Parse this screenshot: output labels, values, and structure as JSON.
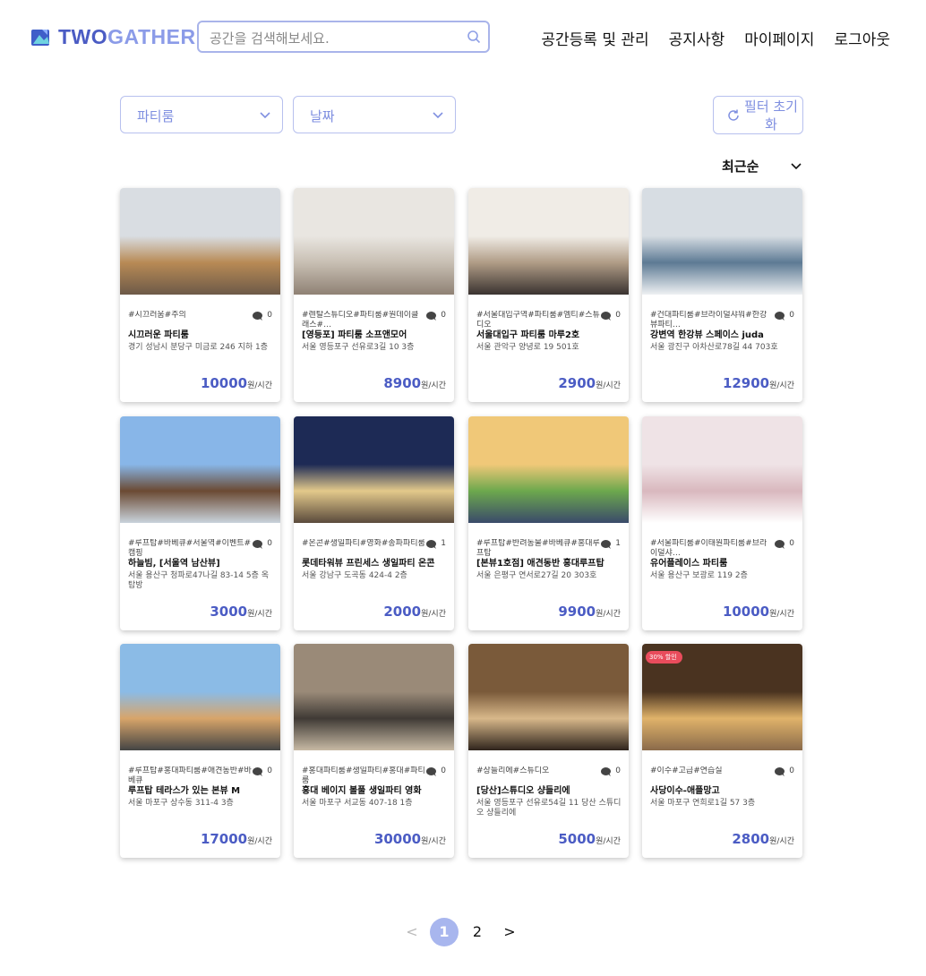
{
  "header": {
    "logo_two": "TWO",
    "logo_gather": "GATHER",
    "search_placeholder": "공간을 검색해보세요.",
    "nav": [
      "공간등록 및 관리",
      "공지사항",
      "마이페이지",
      "로그아웃"
    ]
  },
  "filters": {
    "category": "파티룸",
    "date": "날짜",
    "reset": "필터 초기화",
    "sort": "최근순"
  },
  "price_unit": "원/시간",
  "cards": [
    {
      "tags": "#시끄러움#주의",
      "comments": "0",
      "name": "시끄러운 파티룸",
      "address": "경기 성남시 분당구 미금로 246 지하 1층",
      "price": "10000"
    },
    {
      "tags": "#렌탈스튜디오#파티룸#원데이클래스#…",
      "comments": "0",
      "name": "[영등포] 파티룸 소프앤모어",
      "address": "서울 영등포구 선유로3길 10 3층",
      "price": "8900"
    },
    {
      "tags": "#서울대입구역#파티룸#엠티#스튜디오",
      "comments": "0",
      "name": "서울대입구 파티룸 마루2호",
      "address": "서울 관악구 양녕로 19 501호",
      "price": "2900"
    },
    {
      "tags": "#건대파티룸#브라이덜샤워#한강뷰파티…",
      "comments": "0",
      "name": "강변역 한강뷰 스페이스 juda",
      "address": "서울 광진구 아차산로78길 44 703호",
      "price": "12900"
    },
    {
      "tags": "#루프탑#바베큐#서울역#이벤트#캠핑",
      "comments": "0",
      "name": "하늘빔, [서울역 남산뷰]",
      "address": "서울 용산구 청파로47나길 83-14 5층 옥탑방",
      "price": "3000"
    },
    {
      "tags": "#온콘#생일파티#영화#송파파티룸",
      "comments": "1",
      "name": "롯데타워뷰 프린세스 생일파티 온콘",
      "address": "서울 강남구 도곡동 424-4 2층",
      "price": "2000"
    },
    {
      "tags": "#루프탑#반려동물#바베큐#홍대루프탑",
      "comments": "1",
      "name": "[본뷰1호점] 애견동반 홍대루프탑",
      "address": "서울 은평구 연서로27길 20 303호",
      "price": "9900"
    },
    {
      "tags": "#서울파티룸#이태원파티룸#브라이덜샤…",
      "comments": "0",
      "name": "유어플레이스 파티룸",
      "address": "서울 용산구 보광로 119 2층",
      "price": "10000"
    },
    {
      "tags": "#루프탑#홍대파티룸#애견동반#바베큐",
      "comments": "0",
      "name": "루프탑 테라스가 있는 본뷰 M",
      "address": "서울 마포구 상수동 311-4 3층",
      "price": "17000"
    },
    {
      "tags": "#홍대파티룸#생일파티#홍대#파티룸",
      "comments": "0",
      "name": "홍대 베이지 볼풀 생일파티 영화",
      "address": "서울 마포구 서교동 407-18 1층",
      "price": "30000"
    },
    {
      "tags": "#상들리에#스튜디오",
      "comments": "0",
      "name": "[당산]스튜디오 샹들리에",
      "address": "서울 영등포구 선유로54길 11 당산 스튜디오 샹들리에",
      "price": "5000"
    },
    {
      "tags": "#이수#고급#연습실",
      "comments": "0",
      "name": "사당이수-애플망고",
      "address": "서울 마포구 연희로1길 57 3층",
      "price": "2800",
      "badge": "30% 할인"
    }
  ],
  "pagination": {
    "prev": "<",
    "pages": [
      "1",
      "2"
    ],
    "current": "1",
    "next": ">"
  }
}
